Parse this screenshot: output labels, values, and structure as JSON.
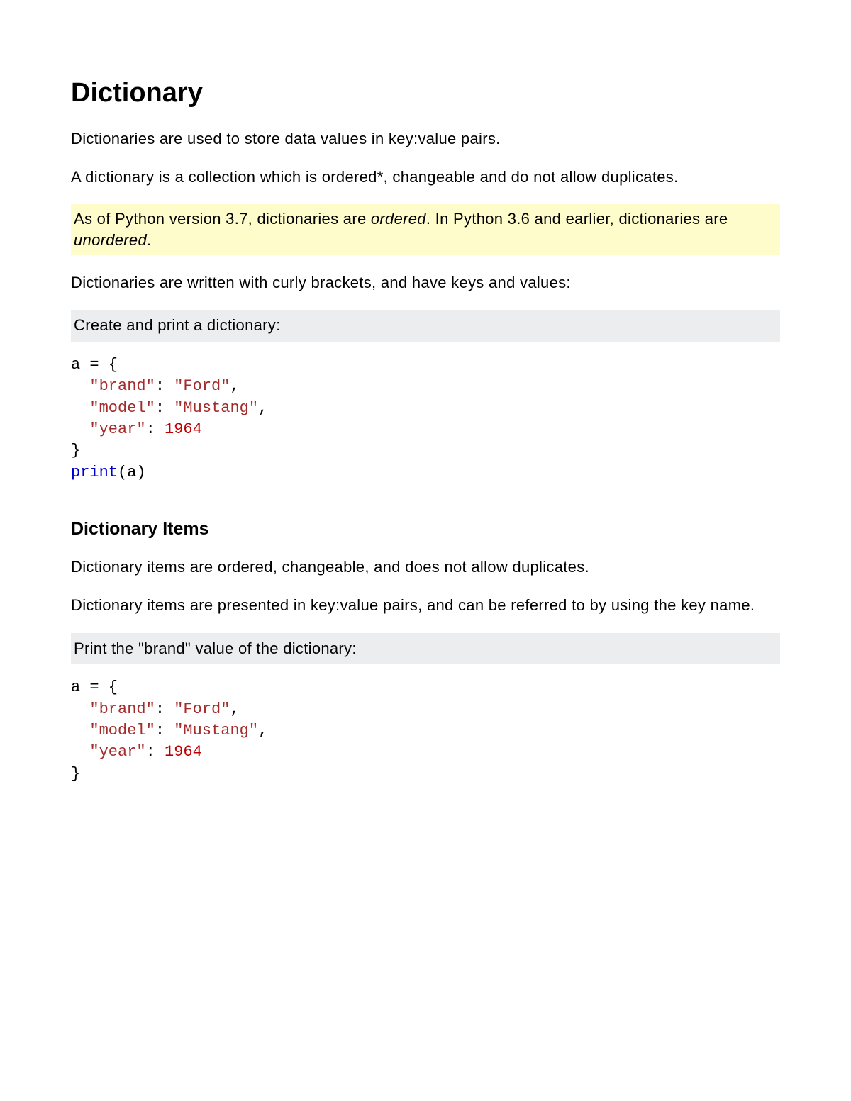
{
  "title": "Dictionary",
  "p1": "Dictionaries are used to store data values in key:value pairs.",
  "p2": "A dictionary is a collection which is ordered*, changeable and do not allow duplicates.",
  "note": {
    "t1": "As of Python version 3.7, dictionaries are ",
    "i1": "ordered",
    "t2": ". In Python 3.6 and earlier, dictionaries are ",
    "i2": "unordered",
    "t3": "."
  },
  "p3": "Dictionaries are written with curly brackets, and have keys and values:",
  "ex1": {
    "label": "Create and print a dictionary:",
    "l1a": "a = {",
    "l2a": "  ",
    "l2b": "\"brand\"",
    "l2c": ": ",
    "l2d": "\"Ford\"",
    "l2e": ",",
    "l3a": "  ",
    "l3b": "\"model\"",
    "l3c": ": ",
    "l3d": "\"Mustang\"",
    "l3e": ",",
    "l4a": "  ",
    "l4b": "\"year\"",
    "l4c": ": ",
    "l4d": "1964",
    "l5a": "}",
    "l6a": "print",
    "l6b": "(a)"
  },
  "h2": "Dictionary Items",
  "p4": "Dictionary items are ordered, changeable, and does not allow duplicates.",
  "p5": "Dictionary items are presented in key:value pairs, and can be referred to by using the key name.",
  "ex2": {
    "label": "Print the \"brand\" value of the dictionary:",
    "l1a": "a = {",
    "l2a": "  ",
    "l2b": "\"brand\"",
    "l2c": ": ",
    "l2d": "\"Ford\"",
    "l2e": ",",
    "l3a": "  ",
    "l3b": "\"model\"",
    "l3c": ": ",
    "l3d": "\"Mustang\"",
    "l3e": ",",
    "l4a": "  ",
    "l4b": "\"year\"",
    "l4c": ": ",
    "l4d": "1964",
    "l5a": "}"
  }
}
